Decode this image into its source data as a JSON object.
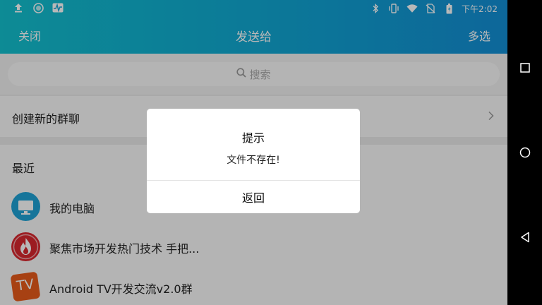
{
  "status_bar": {
    "time": "下午2:02",
    "left_icons": [
      "upload-icon",
      "sync-icon",
      "activity-icon"
    ],
    "right_icons": [
      "bluetooth-icon",
      "vibrate-icon",
      "wifi-icon",
      "no-sim-icon",
      "battery-icon"
    ]
  },
  "title_bar": {
    "close_label": "关闭",
    "title": "发送给",
    "multi_select_label": "多选"
  },
  "search": {
    "placeholder": "搜索"
  },
  "create_group": {
    "label": "创建新的群聊"
  },
  "recent": {
    "header": "最近",
    "items": [
      {
        "name": "我的电脑",
        "avatar": "computer-avatar",
        "color": "#1fa3d6"
      },
      {
        "name": "聚焦市场开发热门技术 手把...",
        "avatar": "flame-avatar",
        "color": "#d9272e"
      },
      {
        "name": "Android TV开发交流v2.0群",
        "avatar": "tv-avatar",
        "color": "#e85a1b",
        "avatar_text": "TV"
      }
    ]
  },
  "dialog": {
    "title": "提示",
    "message": "文件不存在!",
    "button_label": "返回"
  },
  "nav_bar": {
    "buttons": [
      "recents-button",
      "home-button",
      "back-button"
    ]
  },
  "colors": {
    "header_start": "#12c1cf",
    "header_end": "#128fd6"
  }
}
